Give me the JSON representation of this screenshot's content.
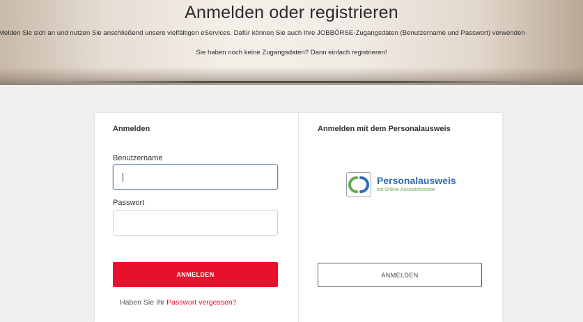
{
  "hero": {
    "title": "Anmelden oder registrieren",
    "description": "Melden Sie sich an und nutzen Sie anschließend unsere vielfältigen eServices. Dafür können Sie auch Ihre JOBBÖRSE-Zugangsdaten (Benutzername und Passwort) verwenden",
    "register_hint": "Sie haben noch keine Zugangsdaten? Dann einfach registrieren!"
  },
  "login": {
    "heading": "Anmelden",
    "username_label": "Benutzername",
    "username_value": "",
    "password_label": "Passwort",
    "password_value": "",
    "submit_label": "ANMELDEN",
    "forgot_prefix": "Haben Sie Ihr ",
    "forgot_link": "Passwort vergessen?"
  },
  "id_card": {
    "heading": "Anmelden mit dem Personalausweis",
    "logo_name": "Personalausweis",
    "logo_subtitle": "mit Online-Ausweisfunktion",
    "submit_label": "ANMELDEN"
  },
  "colors": {
    "accent_red": "#e8102a",
    "logo_blue": "#2f6db5",
    "logo_green": "#6aa84f"
  },
  "icons": {
    "id_card_logo": "personalausweis-logo-icon"
  }
}
